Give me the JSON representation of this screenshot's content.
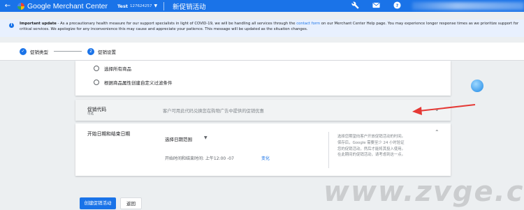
{
  "appbar": {
    "back_icon": "arrow-back-icon",
    "app_name": "Google Merchant Center",
    "account_name": "Test",
    "account_id": "127624257",
    "page_title": "新促销活动",
    "icons": [
      "wrench-icon",
      "mail-icon",
      "help-icon"
    ]
  },
  "banner": {
    "title": "Important update",
    "text_before_link": " - As a precautionary health measure for our support specialists in light of COVID-19, we will be handling all services through the ",
    "link": "contact form",
    "text_after_link": " on our Merchant Center Help page. You may experience longer response times as we prioritize support for critical services. We apologize for any inconvenience this may cause and appreciate your patience. This message will be updated as the situation changes."
  },
  "stepper": {
    "step1_label": "促销类型",
    "step2_number": "2",
    "step2_label": "促销设置"
  },
  "products_card": {
    "option_all": "选择所有商品",
    "option_filter": "根据商品属性创建自定义过滤条件"
  },
  "promo_code": {
    "title": "促销代码",
    "subtitle": "可选",
    "description": "客户可用此代码兑换您在购物广告中提供的促销优惠"
  },
  "dates": {
    "title": "开始日期和结束日期",
    "select_value": "选择日期范围",
    "time_label": "开始时间和结束时间: 上午12:00 -07",
    "change_link": "变化",
    "help_text": "选择您期望向客户开放促销活动的时间。保存后，Google 需要至少 24 小时验证您的促销活动，然后才能将其投入使用。在此期间的促销活动，请考虑到这一点。"
  },
  "actions": {
    "create_label": "创建促销活动",
    "back_label": "返回"
  },
  "watermark": "www.zvge.cn",
  "colors": {
    "primary": "#1a73e8",
    "annotation_arrow": "#e53935"
  }
}
